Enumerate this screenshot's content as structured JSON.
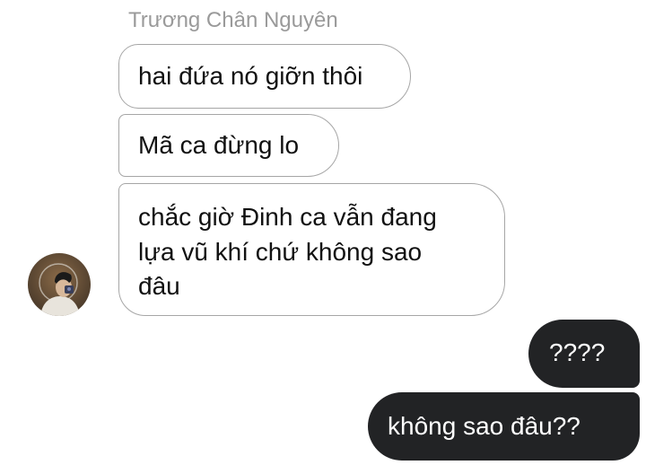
{
  "conversation": {
    "sender_name": "Trương Chân Nguyên",
    "incoming_messages": [
      {
        "text": "hai đứa nó giỡn thôi"
      },
      {
        "text": "Mã ca đừng lo"
      },
      {
        "line1": "chắc giờ Đinh ca vẫn đang",
        "line2": "lựa vũ khí chứ không sao",
        "line3": "đâu"
      }
    ],
    "outgoing_messages": [
      {
        "text": "????"
      },
      {
        "text": "không sao đâu??"
      }
    ]
  },
  "colors": {
    "incoming_bubble_bg": "#ffffff",
    "incoming_bubble_border": "#a6a6a6",
    "outgoing_bubble_bg": "#222325",
    "outgoing_text": "#ffffff",
    "sender_name": "#9a9a9a"
  },
  "icons": {
    "avatar": "profile-photo-avatar"
  }
}
